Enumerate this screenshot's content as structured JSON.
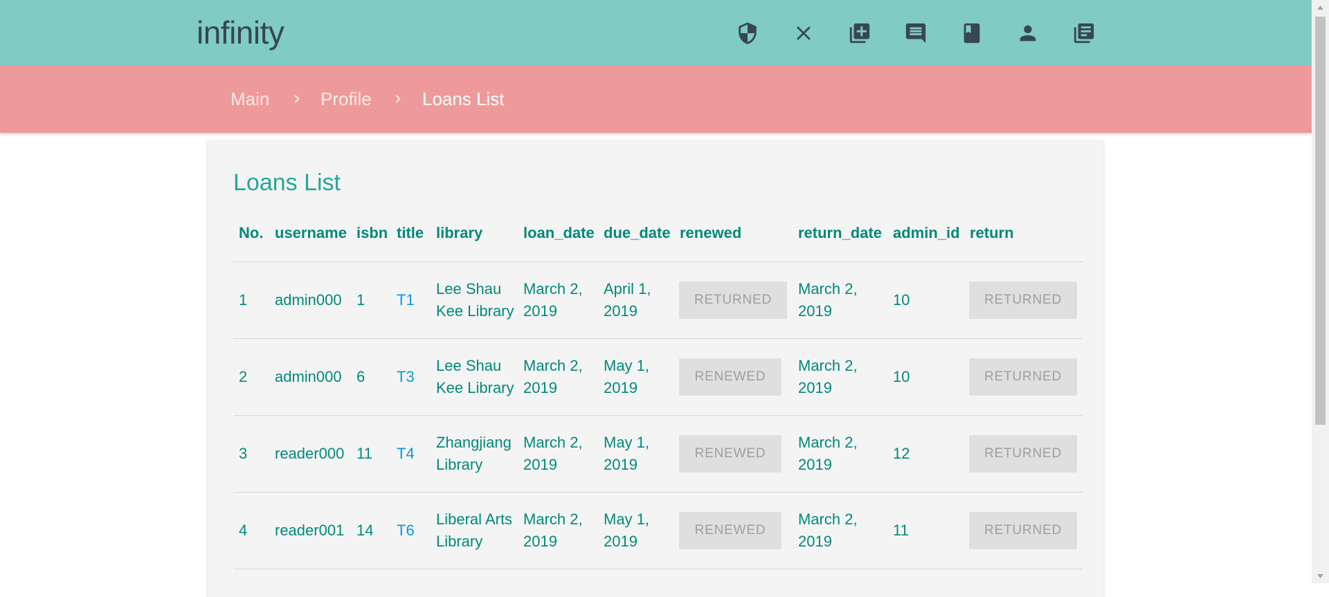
{
  "app": {
    "brand": "infinity"
  },
  "nav_icons": [
    "shield-icon",
    "close-icon",
    "add-box-icon",
    "comment-icon",
    "book-icon",
    "person-icon",
    "library-books-icon"
  ],
  "breadcrumb": [
    "Main",
    "Profile",
    "Loans List"
  ],
  "page_title": "Loans List",
  "columns": [
    "No.",
    "username",
    "isbn",
    "title",
    "library",
    "loan_date",
    "due_date",
    "renewed",
    "return_date",
    "admin_id",
    "return"
  ],
  "rows": [
    {
      "no": "1",
      "username": "admin000",
      "isbn": "1",
      "title": "T1",
      "library": [
        "Lee Shau",
        "Kee Library"
      ],
      "loan_date": [
        "March 2,",
        "2019"
      ],
      "due_date": [
        "April 1,",
        "2019"
      ],
      "renewed": "RETURNED",
      "return_date": [
        "March 2,",
        "2019"
      ],
      "admin_id": "10",
      "return": "RETURNED"
    },
    {
      "no": "2",
      "username": "admin000",
      "isbn": "6",
      "title": "T3",
      "library": [
        "Lee Shau",
        "Kee Library"
      ],
      "loan_date": [
        "March 2,",
        "2019"
      ],
      "due_date": [
        "May 1,",
        "2019"
      ],
      "renewed": "RENEWED",
      "return_date": [
        "March 2,",
        "2019"
      ],
      "admin_id": "10",
      "return": "RETURNED"
    },
    {
      "no": "3",
      "username": "reader000",
      "isbn": "11",
      "title": "T4",
      "library": [
        "Zhangjiang",
        "Library"
      ],
      "loan_date": [
        "March 2,",
        "2019"
      ],
      "due_date": [
        "May 1,",
        "2019"
      ],
      "renewed": "RENEWED",
      "return_date": [
        "March 2,",
        "2019"
      ],
      "admin_id": "12",
      "return": "RETURNED"
    },
    {
      "no": "4",
      "username": "reader001",
      "isbn": "14",
      "title": "T6",
      "library": [
        "Liberal Arts",
        "Library"
      ],
      "loan_date": [
        "March 2,",
        "2019"
      ],
      "due_date": [
        "May 1,",
        "2019"
      ],
      "renewed": "RENEWED",
      "return_date": [
        "March 2,",
        "2019"
      ],
      "admin_id": "11",
      "return": "RETURNED"
    }
  ],
  "colors": {
    "header": "#80cbc4",
    "breadcrumb_bar": "#ef9a9a",
    "teal_text": "#00897b",
    "link": "#039be5",
    "button_bg": "#dfdfdf",
    "button_text": "#9f9f9f"
  }
}
